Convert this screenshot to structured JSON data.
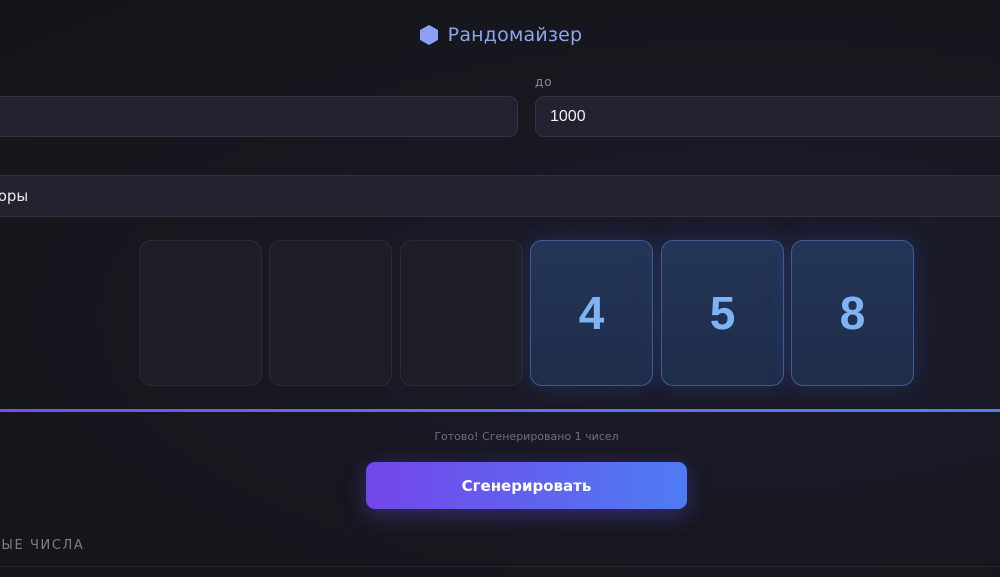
{
  "header": {
    "title": "Рандомайзер",
    "icon": "hexagon-icon",
    "icon_color": "#8da0f5"
  },
  "range": {
    "from_value": "",
    "to_label": "до",
    "to_value": "1000"
  },
  "mode": {
    "selected": "торы"
  },
  "digits": [
    "",
    "",
    "",
    "4",
    "5",
    "8"
  ],
  "status": {
    "text": "Готово! Сгенерировано 1 чисел"
  },
  "actions": {
    "generate_label": "Сгенерировать"
  },
  "history": {
    "label": "НЫЕ ЧИСЛА"
  },
  "colors": {
    "accent_start": "#7446ea",
    "accent_end": "#4e7cf3",
    "digit_text": "#7eb4f5",
    "background": "#16161f"
  }
}
